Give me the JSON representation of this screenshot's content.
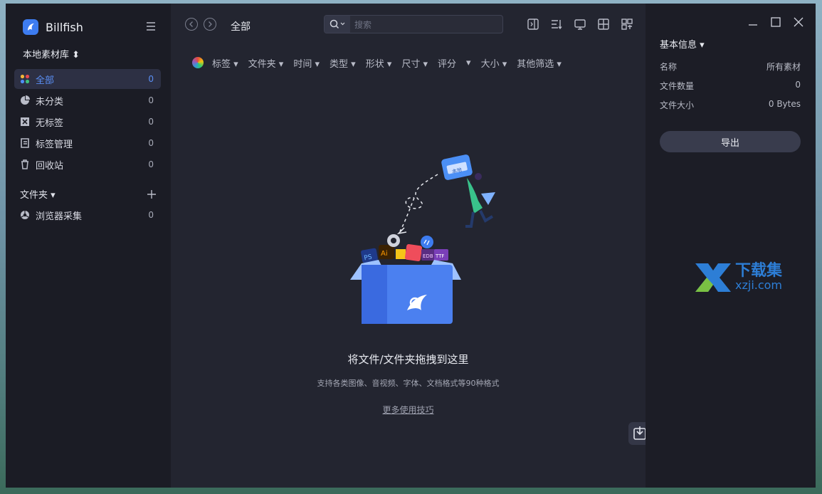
{
  "app": {
    "name": "Billfish",
    "library": "本地素材库 ⬍"
  },
  "sidebar": {
    "items": [
      {
        "label": "全部",
        "count": "0"
      },
      {
        "label": "未分类",
        "count": "0"
      },
      {
        "label": "无标签",
        "count": "0"
      },
      {
        "label": "标签管理",
        "count": "0"
      },
      {
        "label": "回收站",
        "count": "0"
      }
    ],
    "folders_label": "文件夹 ▾",
    "folders": [
      {
        "label": "浏览器采集",
        "count": "0"
      }
    ]
  },
  "toolbar": {
    "breadcrumb": "全部",
    "search_placeholder": "搜索"
  },
  "filters": [
    "标签 ▾",
    "文件夹 ▾",
    "时间 ▾",
    "类型 ▾",
    "形状 ▾",
    "尺寸 ▾",
    "评分",
    "▾",
    "大小 ▾",
    "其他筛选 ▾"
  ],
  "empty": {
    "box_badge": "本地",
    "title": "将文件/文件夹拖拽到这里",
    "subtitle": "支持各类图像、音视频、字体、文档格式等90种格式",
    "link": "更多使用技巧"
  },
  "info": {
    "header": "基本信息 ▾",
    "rows": [
      {
        "key": "名称",
        "value": "所有素材"
      },
      {
        "key": "文件数量",
        "value": "0"
      },
      {
        "key": "文件大小",
        "value": "0 Bytes"
      }
    ],
    "export_label": "导出"
  },
  "watermark": {
    "line1": "下载集",
    "line2": "xzji.com"
  },
  "colors": {
    "accent": "#5a8ff5",
    "sidebar_bg": "#1b1c25",
    "main_bg": "#232530"
  }
}
